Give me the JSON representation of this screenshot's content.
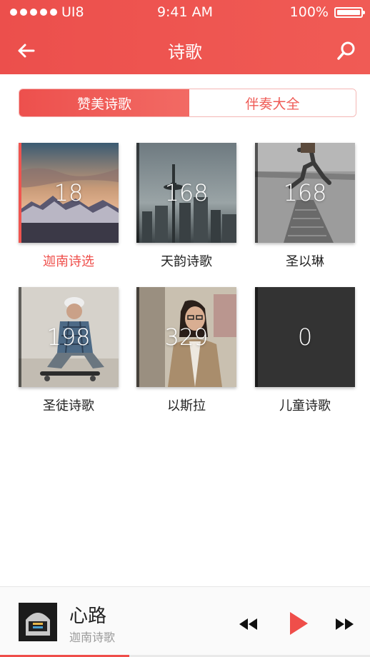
{
  "status_bar": {
    "carrier": "UI8",
    "time": "9:41 AM",
    "battery": "100%"
  },
  "header": {
    "title": "诗歌",
    "back_icon": "arrow-left-icon",
    "search_icon": "search-icon"
  },
  "tabs": [
    {
      "label": "赞美诗歌",
      "active": true
    },
    {
      "label": "伴奏大全",
      "active": false
    }
  ],
  "collections": [
    {
      "label": "迦南诗选",
      "count": "18",
      "active": true
    },
    {
      "label": "天韵诗歌",
      "count": "168",
      "active": false
    },
    {
      "label": "圣以琳",
      "count": "168",
      "active": false
    },
    {
      "label": "圣徒诗歌",
      "count": "198",
      "active": false
    },
    {
      "label": "以斯拉",
      "count": "329",
      "active": false
    },
    {
      "label": "儿童诗歌",
      "count": "0",
      "active": false
    }
  ],
  "player": {
    "song_title": "心路",
    "song_subtitle": "迦南诗歌",
    "progress": 0.35,
    "controls": [
      "rewind-icon",
      "play-icon",
      "fast-forward-icon"
    ]
  },
  "colors": {
    "accent": "#ef4e4a",
    "header_start": "#ec4f4c",
    "header_end": "#f05b55"
  }
}
